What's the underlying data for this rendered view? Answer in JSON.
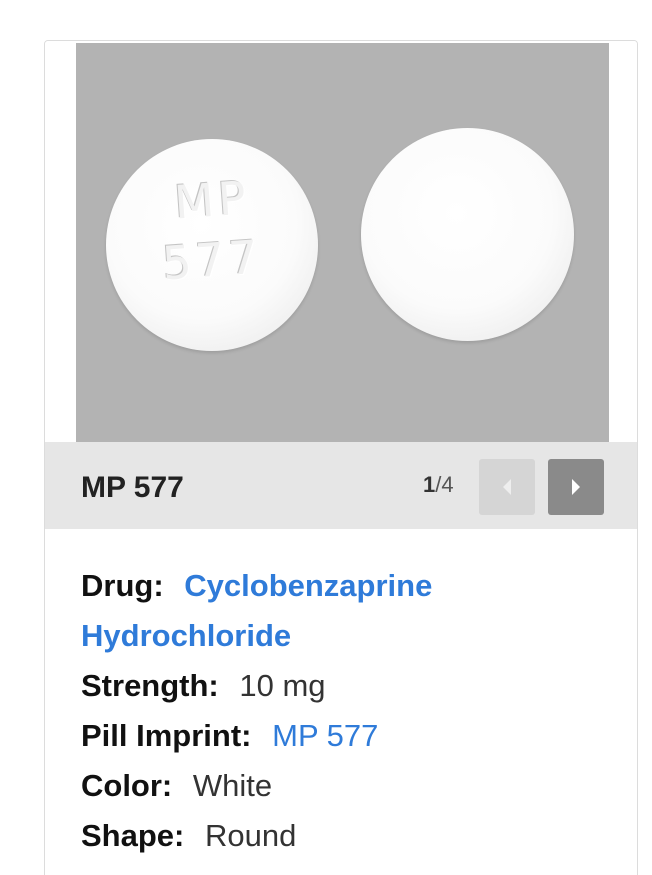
{
  "card": {
    "image": {
      "imprint_line1": "MP",
      "imprint_line2": "577"
    },
    "caption": {
      "title": "MP 577",
      "counter_current": "1",
      "counter_total": "/4"
    },
    "details": {
      "drug_label": "Drug:",
      "drug_value_line1": "Cyclobenzaprine",
      "drug_value_line2": "Hydrochloride",
      "strength_label": "Strength:",
      "strength_value": "10 mg",
      "imprint_label": "Pill Imprint:",
      "imprint_value": "MP 577",
      "color_label": "Color:",
      "color_value": "White",
      "shape_label": "Shape:",
      "shape_value": "Round"
    }
  },
  "colors": {
    "link": "#2f7bd9",
    "photo_background": "#b3b3b3",
    "caption_bar": "#e6e6e6",
    "next_button": "#8a8a8a",
    "prev_button_disabled": "#d5d5d5"
  },
  "icons": {
    "prev": "chevron-left-icon",
    "next": "chevron-right-icon"
  }
}
